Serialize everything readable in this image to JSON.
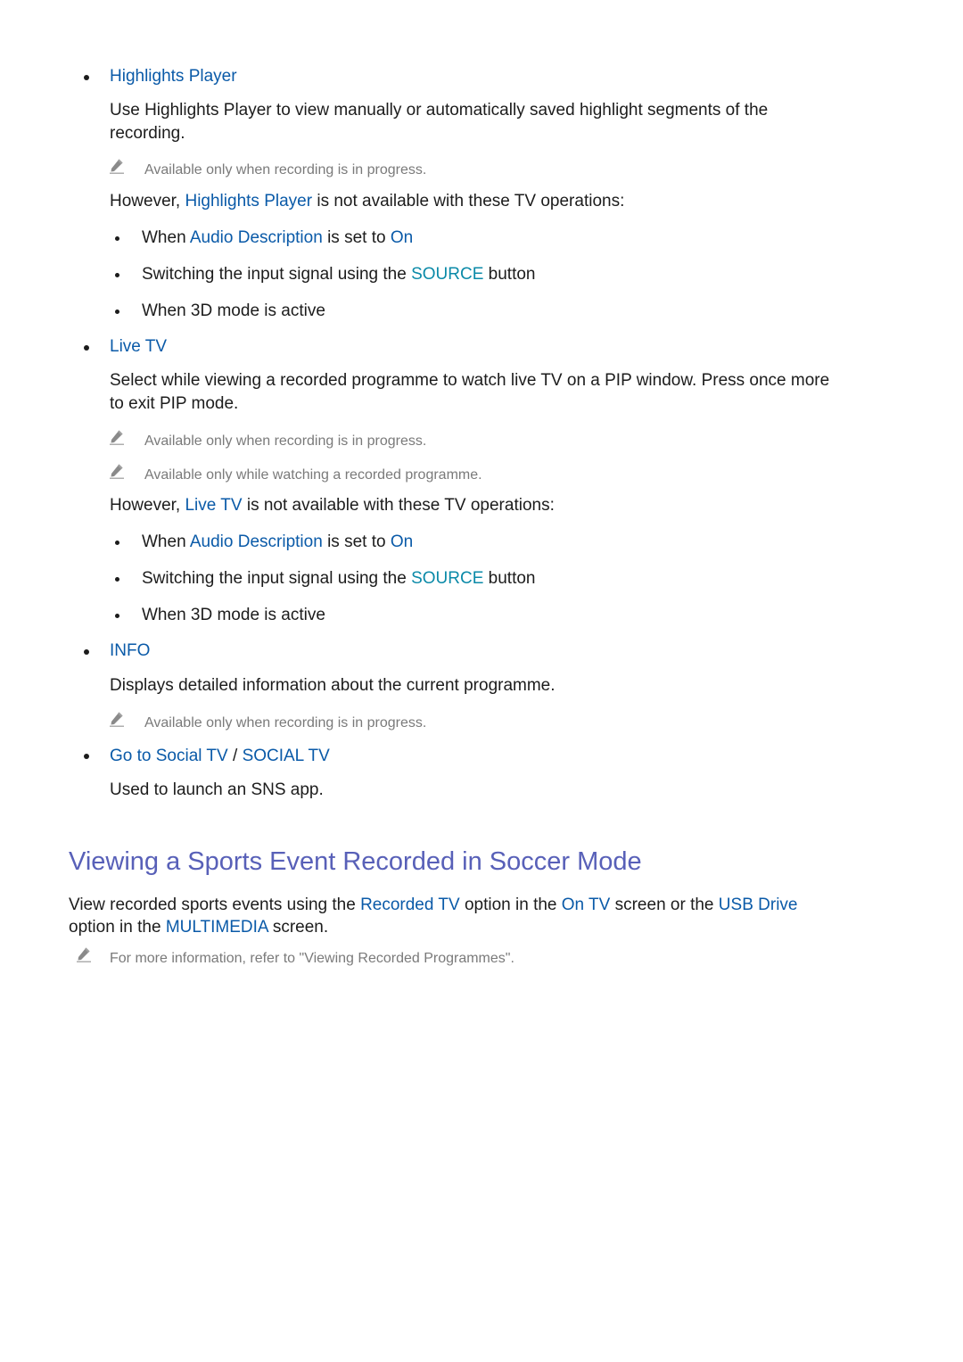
{
  "sections": {
    "highlights_player": {
      "title": "Highlights Player",
      "description_line1": "Use Highlights Player to view manually or automatically saved highlight segments of the",
      "description_line2": "recording.",
      "note": "Available only when recording is in progress.",
      "however_prefix": "However,",
      "however_link": "Highlights Player",
      "however_suffix": "is not available with these TV operations:",
      "restrictions": [
        {
          "pre": "When",
          "link": "Audio Description",
          "mid": "is set to",
          "link2": "On"
        },
        {
          "pre": "Switching the input signal using the",
          "link": "SOURCE",
          "post": "button"
        },
        {
          "text": "When 3D mode is active"
        }
      ]
    },
    "live_tv": {
      "title": "Live TV",
      "description_line1": "Select while viewing a recorded programme to watch live TV on a PIP window. Press once more",
      "description_line2": "to exit PIP mode.",
      "notes": [
        "Available only when recording is in progress.",
        "Available only while watching a recorded programme."
      ],
      "however_prefix": "However,",
      "however_link": "Live TV",
      "however_suffix": "is not available with these TV operations:",
      "restrictions": [
        {
          "pre": "When",
          "link": "Audio Description",
          "mid": "is set to",
          "link2": "On"
        },
        {
          "pre": "Switching the input signal using the",
          "link": "SOURCE",
          "post": "button"
        },
        {
          "text": "When 3D mode is active"
        }
      ]
    },
    "info": {
      "title": "INFO",
      "description": "Displays detailed information about the current programme.",
      "note": "Available only when recording is in progress."
    },
    "social_tv": {
      "title_a": "Go to Social TV",
      "separator": "/",
      "title_b": "SOCIAL TV",
      "description": "Used to launch an SNS app."
    }
  },
  "soccer_section": {
    "heading": "Viewing a Sports Event Recorded in Soccer Mode",
    "line1": {
      "p1": "View recorded sports events using the",
      "l1": "Recorded TV",
      "p2": "option in the",
      "l2": "On TV",
      "p3": "screen or the",
      "l3": "USB Drive"
    },
    "line2": {
      "p1": "option in the",
      "l1": "MULTIMEDIA",
      "p2": "screen."
    },
    "note": "For more information, refer to \"Viewing Recorded Programmes\"."
  },
  "icons": {
    "note_icon": "pencil-icon",
    "bullet_icon": "bullet-dot"
  },
  "colors": {
    "link": "#0a5aa8",
    "source_link": "#0b8aa8",
    "heading": "#5860b8",
    "note_text": "#7a7a7a"
  }
}
